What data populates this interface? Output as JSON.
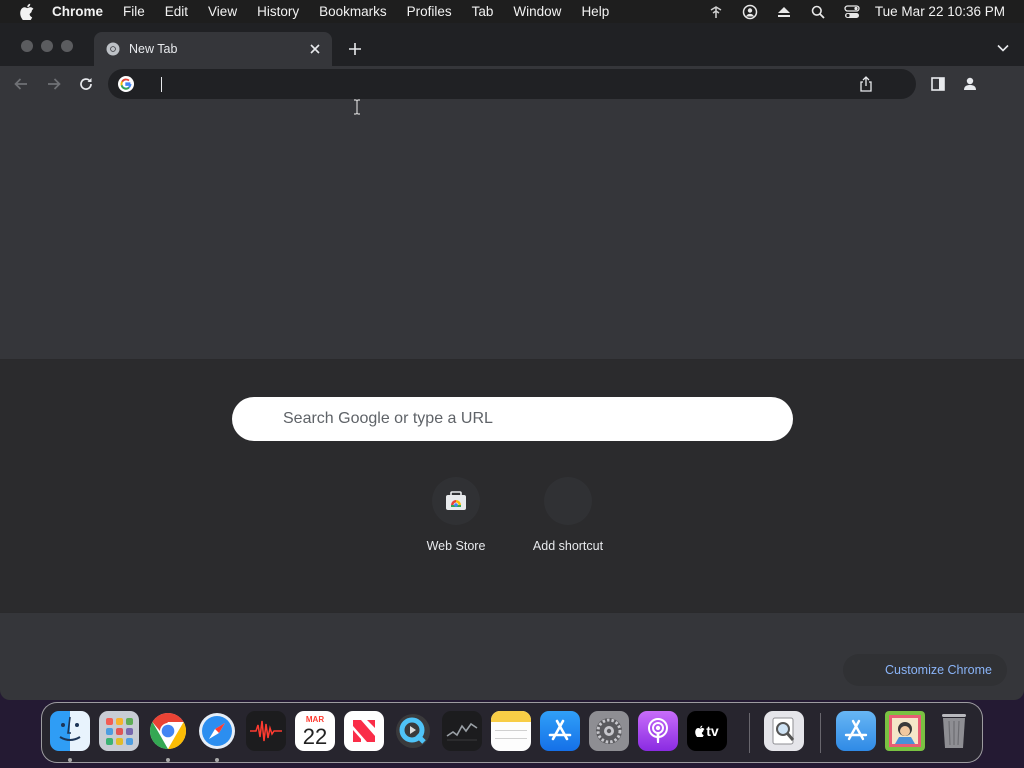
{
  "menubar": {
    "app_name": "Chrome",
    "items": [
      "File",
      "Edit",
      "View",
      "History",
      "Bookmarks",
      "Profiles",
      "Tab",
      "Window",
      "Help"
    ],
    "status_icons": [
      "network-icon",
      "user-account-icon",
      "eject-icon",
      "spotlight-search-icon",
      "control-center-icon"
    ],
    "clock": "Tue Mar 22  10:36 PM"
  },
  "browser": {
    "tab": {
      "title": "New Tab",
      "favicon": "chrome-icon"
    },
    "omnibox": {
      "value": "",
      "placeholder": ""
    }
  },
  "ntp": {
    "search_placeholder": "Search Google or type a URL",
    "shortcuts": [
      {
        "label": "Web Store",
        "icon": "web-store-icon"
      },
      {
        "label": "Add shortcut",
        "icon": "add-shortcut-icon"
      }
    ],
    "customize_label": "Customize Chrome"
  },
  "dock": {
    "calendar": {
      "month": "MAR",
      "day": "22"
    },
    "tv_label": "tv",
    "apps": [
      "Finder",
      "Launchpad",
      "Chrome",
      "Safari",
      "Voice Memos",
      "Calendar",
      "News",
      "QuickTime Player",
      "Stocks",
      "Notes",
      "App Store",
      "System Preferences",
      "Podcasts",
      "TV",
      "Preview",
      "Downloads",
      "Photo",
      "Trash"
    ]
  },
  "colors": {
    "window_bg": "#202124",
    "toolbar_bg": "#35363a",
    "page_bg": "#35363a",
    "link_blue": "#8ab4f8"
  }
}
